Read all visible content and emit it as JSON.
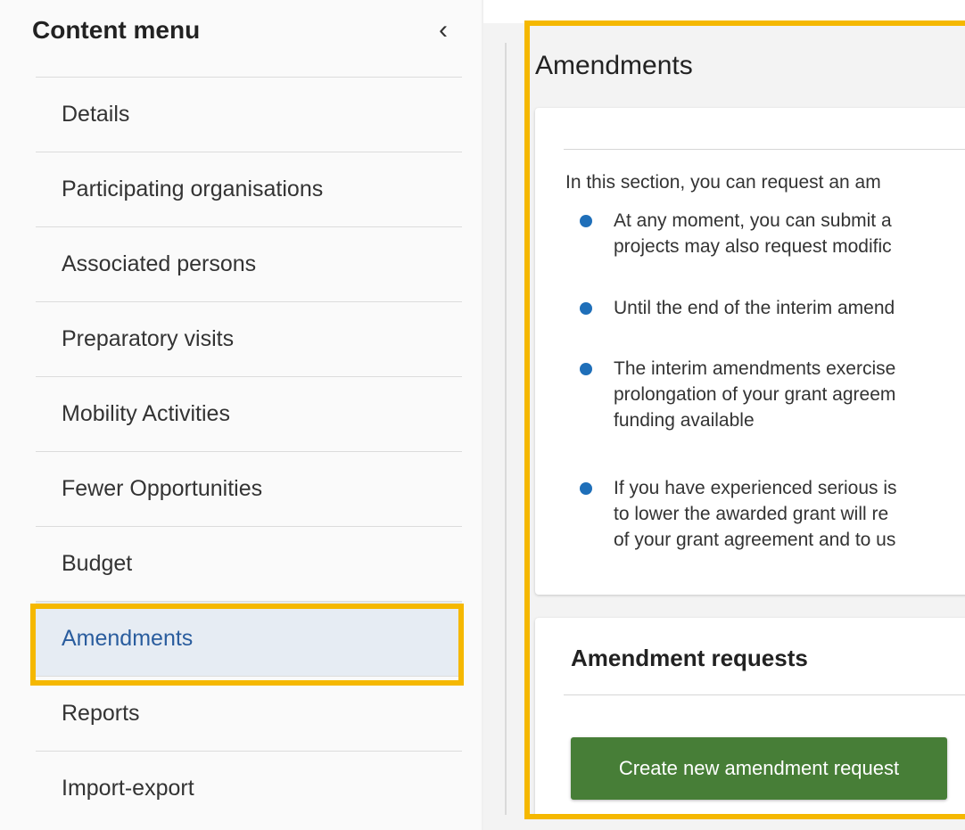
{
  "sidebar": {
    "title": "Content menu",
    "collapse_icon": "chevron-left-icon",
    "collapse_glyph": "‹",
    "items": [
      {
        "label": "Details",
        "active": false
      },
      {
        "label": "Participating organisations",
        "active": false
      },
      {
        "label": "Associated persons",
        "active": false
      },
      {
        "label": "Preparatory visits",
        "active": false
      },
      {
        "label": "Mobility Activities",
        "active": false
      },
      {
        "label": "Fewer Opportunities",
        "active": false
      },
      {
        "label": "Budget",
        "active": false
      },
      {
        "label": "Amendments",
        "active": true
      },
      {
        "label": "Reports",
        "active": false
      },
      {
        "label": "Import-export",
        "active": false
      }
    ]
  },
  "main": {
    "title": "Amendments",
    "intro": "In this section, you can request an am",
    "bullets": [
      {
        "lines": [
          "At any moment, you can submit a",
          "projects may also request modific"
        ]
      },
      {
        "lines": [
          "Until the end of the interim amend"
        ]
      },
      {
        "lines": [
          "The interim amendments exercise",
          "prolongation of your grant agreem",
          "funding available"
        ]
      },
      {
        "lines": [
          "If you have experienced serious is",
          "to lower the awarded grant will re",
          "of your grant agreement and to us"
        ]
      }
    ],
    "requests": {
      "title": "Amendment requests",
      "create_label": "Create new amendment request"
    }
  },
  "colors": {
    "highlight": "#f5b800",
    "bullet": "#1f6fb9",
    "button": "#477e37",
    "active_item_bg": "#e6ecf3",
    "active_item_text": "#2a5d9e"
  }
}
